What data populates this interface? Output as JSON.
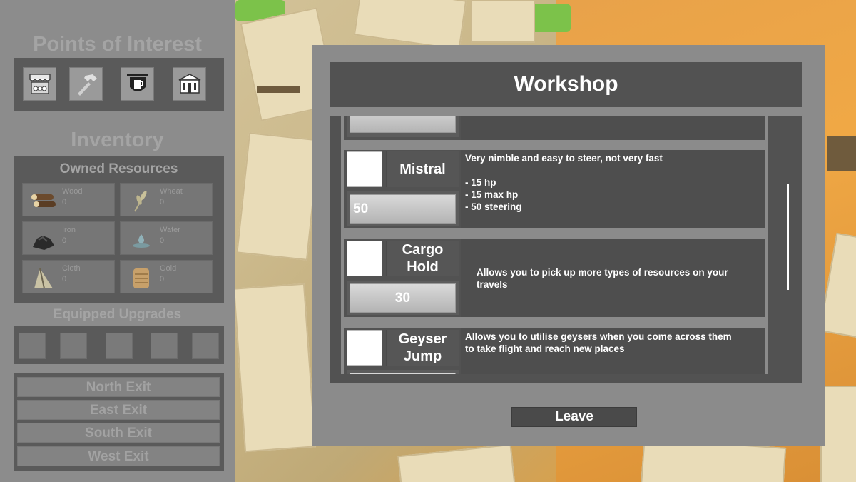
{
  "sidebar": {
    "poi_title": "Points of Interest",
    "poi_icons": [
      "market-stall-icon",
      "hammer-icon",
      "tavern-sign-icon",
      "town-hall-icon"
    ],
    "inventory_title": "Inventory",
    "resources_title": "Owned Resources",
    "resources": [
      {
        "name": "Wood",
        "count": "0",
        "icon": "wood-icon"
      },
      {
        "name": "Wheat",
        "count": "0",
        "icon": "wheat-icon"
      },
      {
        "name": "Iron",
        "count": "0",
        "icon": "iron-icon"
      },
      {
        "name": "Water",
        "count": "0",
        "icon": "water-icon"
      },
      {
        "name": "Cloth",
        "count": "0",
        "icon": "cloth-icon"
      },
      {
        "name": "Gold",
        "count": "0",
        "icon": "gold-icon"
      }
    ],
    "equipped_title": "Equipped Upgrades",
    "exits": [
      "North Exit",
      "East Exit",
      "South Exit",
      "West Exit"
    ]
  },
  "workshop": {
    "title": "Workshop",
    "upgrades": [
      {
        "name": "Mistral",
        "price": "50",
        "description": "Very nimble and easy to steer, not very fast\n\n- 15 hp\n- 15 max hp\n- 50 steering"
      },
      {
        "name": "Cargo Hold",
        "price": "30",
        "description": "Allows you to pick up more types of resources on your travels"
      },
      {
        "name": "Geyser Jump",
        "price": "",
        "description": "Allows you to utilise geysers when you come across them\nto take flight and reach new places"
      }
    ],
    "leave_label": "Leave"
  },
  "colors": {
    "sidebar_bg": "#8c8c8c",
    "panel_bg": "#5a5a5a",
    "modal_bg": "#8b8b8b",
    "modal_panel": "#525252",
    "text_white": "#ffffff",
    "text_faded": "#a4a4a4"
  }
}
